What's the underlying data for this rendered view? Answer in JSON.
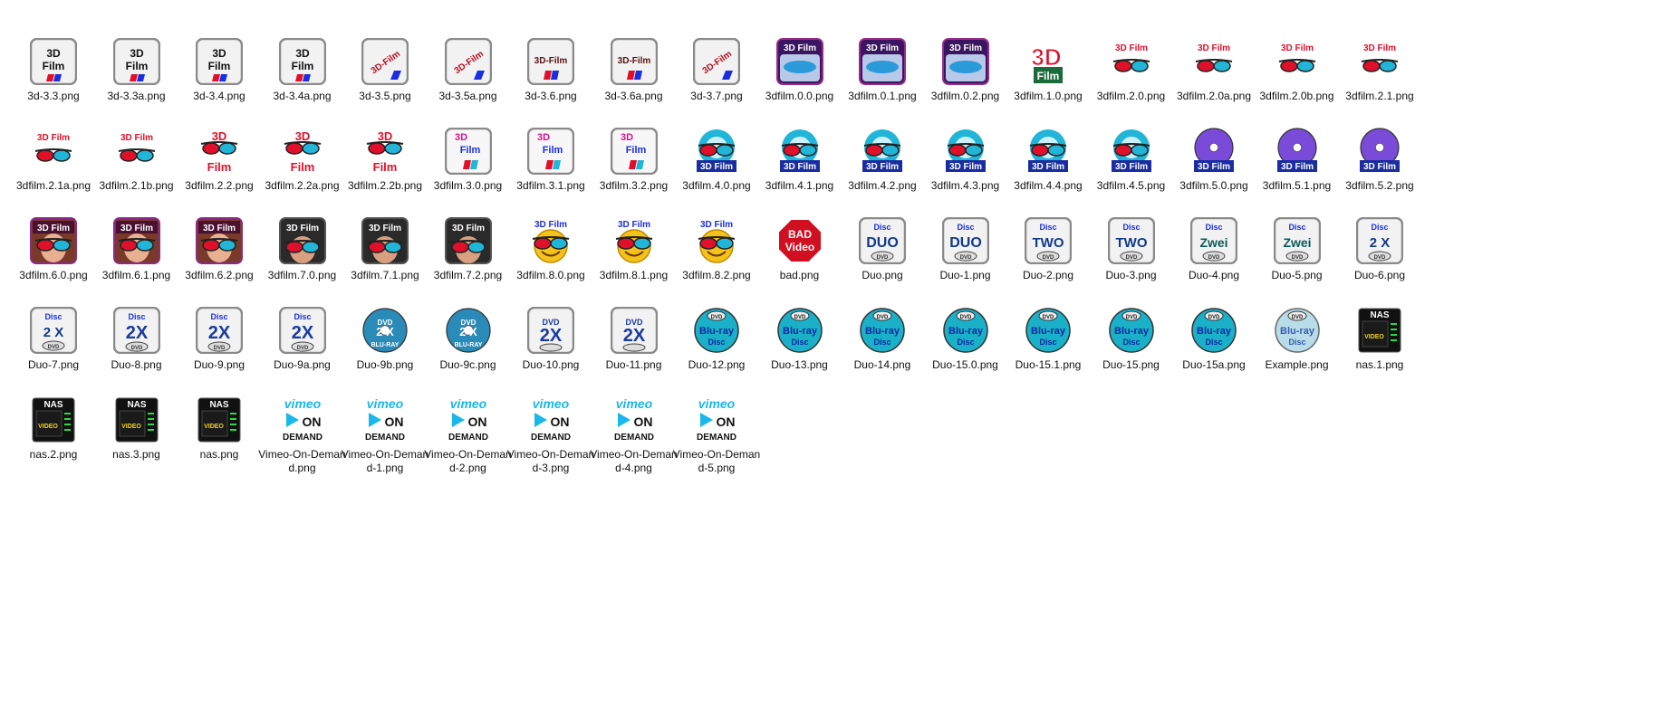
{
  "window": {
    "view": "large-icons"
  },
  "icon_labels": {
    "3d_film": "3D Film",
    "3d_film_dash": "3D-Film",
    "film": "Film",
    "three_d": "3D",
    "bad": "BAD",
    "video": "Video",
    "disc": "Disc",
    "dvd": "DVD",
    "duo": "DUO",
    "two": "TWO",
    "zwei": "Zwei",
    "two_x": "2 X",
    "twox": "2X",
    "blu_ray": "Blu-ray",
    "blu_ray_disc": "Disc",
    "bluray_caps": "BLU-RAY",
    "nas": "NAS",
    "nas_video": "VIDEO",
    "vimeo": "vimeo",
    "on": "ON",
    "demand": "DEMAND"
  },
  "colors": {
    "film_red": "#e0102a",
    "film_blue": "#1a2de0",
    "magenta": "#d6148c",
    "gray_frame": "#8a8a8a",
    "cyan": "#21b5d8",
    "vimeo_blue": "#1ab7ea",
    "smile_yellow": "#f4c21a"
  },
  "files": [
    {
      "name": "3d-3.3.png",
      "icon": "film-box"
    },
    {
      "name": "3d-3.3a.png",
      "icon": "film-box"
    },
    {
      "name": "3d-3.4.png",
      "icon": "film-box"
    },
    {
      "name": "3d-3.4a.png",
      "icon": "film-box"
    },
    {
      "name": "3d-3.5.png",
      "icon": "film-box-diag"
    },
    {
      "name": "3d-3.5a.png",
      "icon": "film-box-diag"
    },
    {
      "name": "3d-3.6.png",
      "icon": "film-box-dash"
    },
    {
      "name": "3d-3.6a.png",
      "icon": "film-box-dash"
    },
    {
      "name": "3d-3.7.png",
      "icon": "film-box-diag"
    },
    {
      "name": "3dfilm.0.0.png",
      "icon": "film-face"
    },
    {
      "name": "3dfilm.0.1.png",
      "icon": "film-face"
    },
    {
      "name": "3dfilm.0.2.png",
      "icon": "film-face"
    },
    {
      "name": "3dfilm.1.0.png",
      "icon": "film-big3d"
    },
    {
      "name": "3dfilm.2.0.png",
      "icon": "film-glasses"
    },
    {
      "name": "3dfilm.2.0a.png",
      "icon": "film-glasses"
    },
    {
      "name": "3dfilm.2.0b.png",
      "icon": "film-glasses"
    },
    {
      "name": "3dfilm.2.1.png",
      "icon": "film-glasses"
    },
    {
      "name": "3dfilm.2.1a.png",
      "icon": "film-glasses"
    },
    {
      "name": "3dfilm.2.1b.png",
      "icon": "film-glasses"
    },
    {
      "name": "3dfilm.2.2.png",
      "icon": "film-glasses-big"
    },
    {
      "name": "3dfilm.2.2a.png",
      "icon": "film-glasses-big"
    },
    {
      "name": "3dfilm.2.2b.png",
      "icon": "film-glasses-big"
    },
    {
      "name": "3dfilm.3.0.png",
      "icon": "film-box-color"
    },
    {
      "name": "3dfilm.3.1.png",
      "icon": "film-box-color"
    },
    {
      "name": "3dfilm.3.2.png",
      "icon": "film-box-color"
    },
    {
      "name": "3dfilm.4.0.png",
      "icon": "film-burst"
    },
    {
      "name": "3dfilm.4.1.png",
      "icon": "film-burst"
    },
    {
      "name": "3dfilm.4.2.png",
      "icon": "film-burst"
    },
    {
      "name": "3dfilm.4.3.png",
      "icon": "film-burst"
    },
    {
      "name": "3dfilm.4.4.png",
      "icon": "film-burst"
    },
    {
      "name": "3dfilm.4.5.png",
      "icon": "film-burst"
    },
    {
      "name": "3dfilm.5.0.png",
      "icon": "film-disc"
    },
    {
      "name": "3dfilm.5.1.png",
      "icon": "film-disc"
    },
    {
      "name": "3dfilm.5.2.png",
      "icon": "film-disc"
    },
    {
      "name": "3dfilm.6.0.png",
      "icon": "film-woman"
    },
    {
      "name": "3dfilm.6.1.png",
      "icon": "film-woman"
    },
    {
      "name": "3dfilm.6.2.png",
      "icon": "film-woman"
    },
    {
      "name": "3dfilm.7.0.png",
      "icon": "film-man"
    },
    {
      "name": "3dfilm.7.1.png",
      "icon": "film-man"
    },
    {
      "name": "3dfilm.7.2.png",
      "icon": "film-man"
    },
    {
      "name": "3dfilm.8.0.png",
      "icon": "film-smile"
    },
    {
      "name": "3dfilm.8.1.png",
      "icon": "film-smile"
    },
    {
      "name": "3dfilm.8.2.png",
      "icon": "film-smile"
    },
    {
      "name": "bad.png",
      "icon": "stop-sign"
    },
    {
      "name": "Duo.png",
      "icon": "duo-box"
    },
    {
      "name": "Duo-1.png",
      "icon": "duo-box"
    },
    {
      "name": "Duo-2.png",
      "icon": "two-box"
    },
    {
      "name": "Duo-3.png",
      "icon": "two-box"
    },
    {
      "name": "Duo-4.png",
      "icon": "zwei-box"
    },
    {
      "name": "Duo-5.png",
      "icon": "zwei-box"
    },
    {
      "name": "Duo-6.png",
      "icon": "twox-box"
    },
    {
      "name": "Duo-7.png",
      "icon": "twox-box"
    },
    {
      "name": "Duo-8.png",
      "icon": "twox-big"
    },
    {
      "name": "Duo-9.png",
      "icon": "twox-big"
    },
    {
      "name": "Duo-9a.png",
      "icon": "twox-big"
    },
    {
      "name": "Duo-9b.png",
      "icon": "bluray-round"
    },
    {
      "name": "Duo-9c.png",
      "icon": "bluray-round"
    },
    {
      "name": "Duo-10.png",
      "icon": "bluray-box"
    },
    {
      "name": "Duo-11.png",
      "icon": "bluray-box"
    },
    {
      "name": "Duo-12.png",
      "icon": "bluray-disc"
    },
    {
      "name": "Duo-13.png",
      "icon": "bluray-disc"
    },
    {
      "name": "Duo-14.png",
      "icon": "bluray-disc"
    },
    {
      "name": "Duo-15.0.png",
      "icon": "bluray-disc"
    },
    {
      "name": "Duo-15.1.png",
      "icon": "bluray-disc"
    },
    {
      "name": "Duo-15.png",
      "icon": "bluray-disc"
    },
    {
      "name": "Duo-15a.png",
      "icon": "bluray-disc"
    },
    {
      "name": "Example.png",
      "icon": "bluray-disc-light"
    },
    {
      "name": "nas.1.png",
      "icon": "nas-box"
    },
    {
      "name": "nas.2.png",
      "icon": "nas-box"
    },
    {
      "name": "nas.3.png",
      "icon": "nas-box"
    },
    {
      "name": "nas.png",
      "icon": "nas-box"
    },
    {
      "name": "Vimeo-On-Demand.png",
      "icon": "vimeo"
    },
    {
      "name": "Vimeo-On-Demand-1.png",
      "icon": "vimeo"
    },
    {
      "name": "Vimeo-On-Demand-2.png",
      "icon": "vimeo"
    },
    {
      "name": "Vimeo-On-Demand-3.png",
      "icon": "vimeo"
    },
    {
      "name": "Vimeo-On-Demand-4.png",
      "icon": "vimeo"
    },
    {
      "name": "Vimeo-On-Demand-5.png",
      "icon": "vimeo"
    }
  ]
}
